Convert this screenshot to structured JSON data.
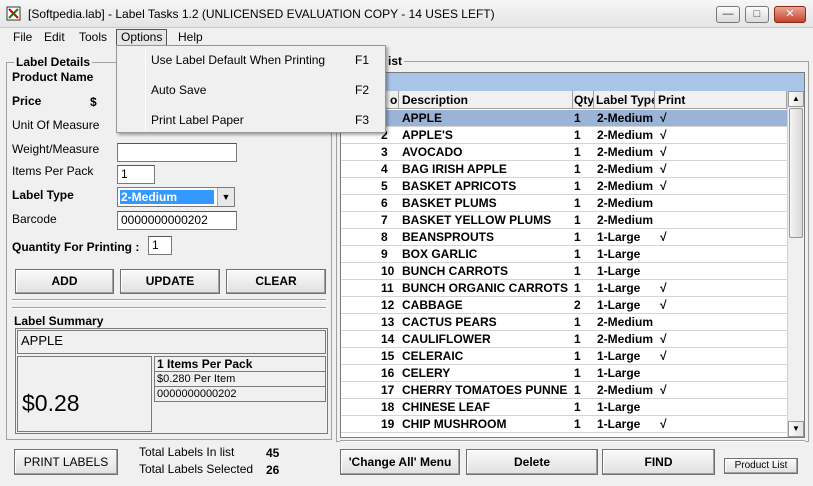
{
  "window": {
    "title": "[Softpedia.lab] - Label Tasks 1.2 (UNLICENSED EVALUATION COPY -  14 USES LEFT)",
    "minimize": "—",
    "maximize": "□",
    "close": "✕"
  },
  "menu": {
    "items": [
      "File",
      "Edit",
      "Tools",
      "Options",
      "Help"
    ],
    "options_dropdown": [
      {
        "label": "Use Label Default When Printing",
        "shortcut": "F1"
      },
      {
        "label": "Auto Save",
        "shortcut": "F2"
      },
      {
        "label": "Print Label Paper",
        "shortcut": "F3"
      }
    ]
  },
  "label_details": {
    "title": "Label Details",
    "product_name_label": "Product Name",
    "price_label": "Price",
    "price_currency": "$",
    "unit_label": "Unit Of Measure",
    "weight_label": "Weight/Measure",
    "items_per_pack_label": "Items Per Pack",
    "items_per_pack_value": "1",
    "label_type_label": "Label Type",
    "label_type_value": "2-Medium",
    "barcode_label": "Barcode",
    "barcode_value": "0000000000202",
    "qty_label": "Quantity For Printing :",
    "qty_value": "1",
    "add_button": "ADD",
    "update_button": "UPDATE",
    "clear_button": "CLEAR"
  },
  "summary": {
    "title": "Label Summary",
    "product": "APPLE",
    "price": "$0.28",
    "items_per_pack": "1 Items Per Pack",
    "per_item": "$0.280 Per Item",
    "barcode": "0000000000202"
  },
  "footer": {
    "print_labels_button": "PRINT LABELS",
    "total_labels_label": "Total Labels In list",
    "total_labels_value": "45",
    "total_selected_label": "Total Labels Selected",
    "total_selected_value": "26",
    "change_all_button": "'Change All' Menu",
    "delete_button": "Delete",
    "find_button": "FIND",
    "product_list_button": "Product List"
  },
  "list": {
    "title_fragment": "ist",
    "columns": [
      "o",
      "Description",
      "Qty",
      "Label Type",
      "Print"
    ],
    "rows": [
      {
        "no": "",
        "desc": "APPLE",
        "qty": "1",
        "type": "2-Medium",
        "print": "√",
        "selected": true
      },
      {
        "no": "2",
        "desc": "APPLE'S",
        "qty": "1",
        "type": "2-Medium",
        "print": "√"
      },
      {
        "no": "3",
        "desc": "AVOCADO",
        "qty": "1",
        "type": "2-Medium",
        "print": "√"
      },
      {
        "no": "4",
        "desc": "BAG IRISH APPLE",
        "qty": "1",
        "type": "2-Medium",
        "print": "√"
      },
      {
        "no": "5",
        "desc": "BASKET APRICOTS",
        "qty": "1",
        "type": "2-Medium",
        "print": "√"
      },
      {
        "no": "6",
        "desc": "BASKET PLUMS",
        "qty": "1",
        "type": "2-Medium",
        "print": ""
      },
      {
        "no": "7",
        "desc": "BASKET YELLOW PLUMS",
        "qty": "1",
        "type": "2-Medium",
        "print": ""
      },
      {
        "no": "8",
        "desc": "BEANSPROUTS",
        "qty": "1",
        "type": "1-Large",
        "print": "√"
      },
      {
        "no": "9",
        "desc": "BOX GARLIC",
        "qty": "1",
        "type": "1-Large",
        "print": ""
      },
      {
        "no": "10",
        "desc": "BUNCH CARROTS",
        "qty": "1",
        "type": "1-Large",
        "print": ""
      },
      {
        "no": "11",
        "desc": "BUNCH ORGANIC CARROTS",
        "qty": "1",
        "type": "1-Large",
        "print": "√"
      },
      {
        "no": "12",
        "desc": "CABBAGE",
        "qty": "2",
        "type": "1-Large",
        "print": "√"
      },
      {
        "no": "13",
        "desc": "CACTUS PEARS",
        "qty": "1",
        "type": "2-Medium",
        "print": ""
      },
      {
        "no": "14",
        "desc": "CAULIFLOWER",
        "qty": "1",
        "type": "2-Medium",
        "print": "√"
      },
      {
        "no": "15",
        "desc": "CELERAIC",
        "qty": "1",
        "type": "1-Large",
        "print": "√"
      },
      {
        "no": "16",
        "desc": "CELERY",
        "qty": "1",
        "type": "1-Large",
        "print": ""
      },
      {
        "no": "17",
        "desc": "CHERRY TOMATOES PUNNE",
        "qty": "1",
        "type": "2-Medium",
        "print": "√"
      },
      {
        "no": "18",
        "desc": "CHINESE LEAF",
        "qty": "1",
        "type": "1-Large",
        "print": ""
      },
      {
        "no": "19",
        "desc": "CHIP MUSHROOM",
        "qty": "1",
        "type": "1-Large",
        "print": "√"
      }
    ]
  },
  "scroll_up": "▲",
  "scroll_down": "▼",
  "dropdown_arrow": "▼"
}
